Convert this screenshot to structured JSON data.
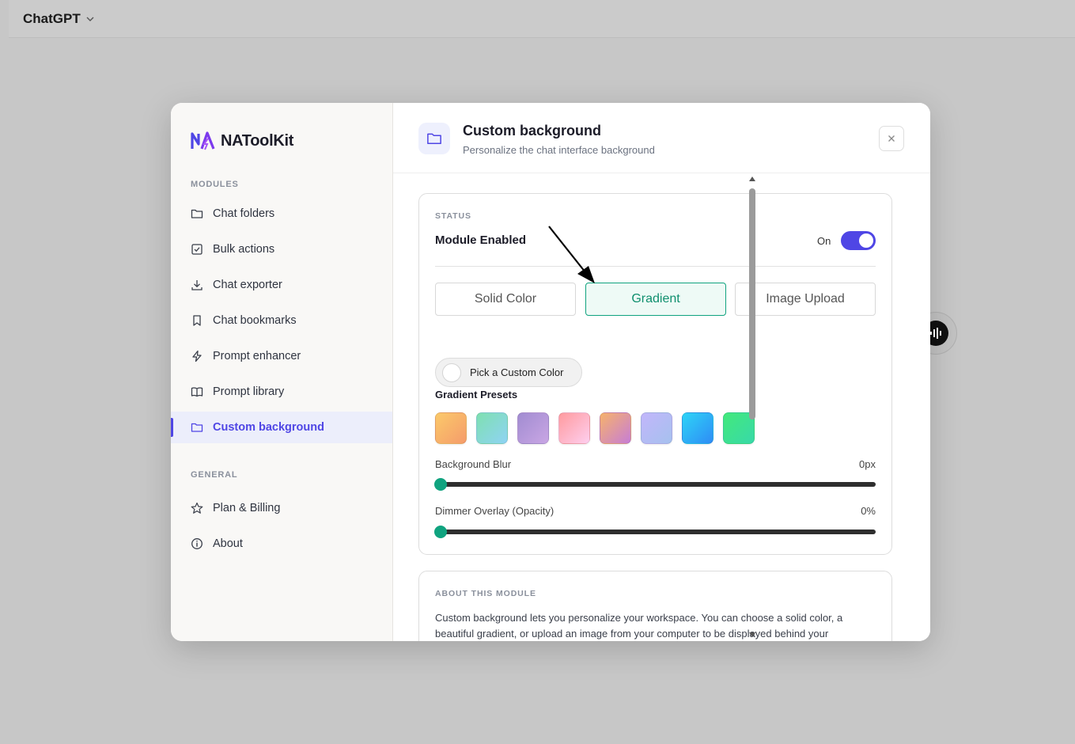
{
  "app": {
    "title": "ChatGPT"
  },
  "sidebar": {
    "brand": "NAToolKit",
    "modules_label": "MODULES",
    "general_label": "GENERAL",
    "modules": [
      {
        "label": "Chat folders",
        "icon": "folder-icon"
      },
      {
        "label": "Bulk actions",
        "icon": "checkbox-icon"
      },
      {
        "label": "Chat exporter",
        "icon": "download-icon"
      },
      {
        "label": "Chat bookmarks",
        "icon": "bookmark-icon"
      },
      {
        "label": "Prompt enhancer",
        "icon": "lightning-icon"
      },
      {
        "label": "Prompt library",
        "icon": "book-icon"
      },
      {
        "label": "Custom background",
        "icon": "folder-icon",
        "active": true
      }
    ],
    "general": [
      {
        "label": "Plan & Billing",
        "icon": "star-icon"
      },
      {
        "label": "About",
        "icon": "info-icon"
      }
    ]
  },
  "header": {
    "title": "Custom background",
    "subtitle": "Personalize the chat interface background"
  },
  "status": {
    "label": "STATUS",
    "module_enabled": "Module Enabled",
    "toggle_text": "On",
    "enabled": true
  },
  "mode_tabs": [
    {
      "label": "Solid Color",
      "active": false
    },
    {
      "label": "Gradient",
      "active": true
    },
    {
      "label": "Image Upload",
      "active": false
    }
  ],
  "custom_color": {
    "label": "Pick a Custom Color"
  },
  "gradient_presets": {
    "label": "Gradient Presets",
    "colors": [
      [
        "#fbc96a",
        "#f59c6b"
      ],
      [
        "#7ee0b0",
        "#8fd3f4"
      ],
      [
        "#a18cd1",
        "#c9a6e4"
      ],
      [
        "#ff9a9e",
        "#fecfef"
      ],
      [
        "#f6b26b",
        "#c77dd6"
      ],
      [
        "#c2b6fb",
        "#a6c1ee"
      ],
      [
        "#2dd4f7",
        "#2f8cf5"
      ],
      [
        "#43e97b",
        "#38d9a9"
      ]
    ]
  },
  "blur": {
    "label": "Background Blur",
    "value": "0px"
  },
  "dimmer": {
    "label": "Dimmer Overlay (Opacity)",
    "value": "0%"
  },
  "about": {
    "label": "ABOUT THIS MODULE",
    "text": "Custom background lets you personalize your workspace. You can choose a solid color, a beautiful gradient, or upload an image from your computer to be displayed behind your"
  },
  "colors": {
    "accent": "#4f46e5",
    "active_green": "#10a37f"
  }
}
